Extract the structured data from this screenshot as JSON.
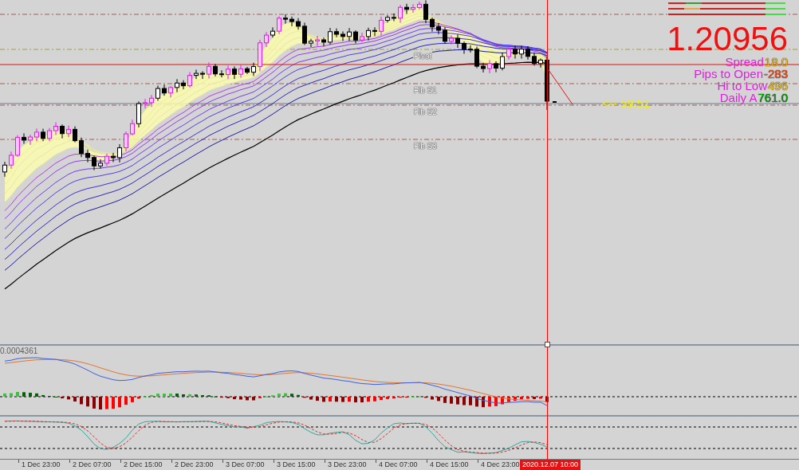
{
  "price_chart": {
    "current_price": "1.20956",
    "stats": [
      {
        "label": "Spread",
        "value": "18.0",
        "color": "#f0c010"
      },
      {
        "label": "Pips to Open",
        "value": "-283",
        "color": "#ff4a10"
      },
      {
        "label": "Hi to Low",
        "value": "496",
        "color": "#e8c030"
      },
      {
        "label": "Daily A",
        "value": "761.0",
        "color": "#00a000"
      }
    ],
    "countdown": "<-- 59:51",
    "levels": [
      {
        "label": "Pivot"
      },
      {
        "label": "Fib S1"
      },
      {
        "label": "Fib S2"
      },
      {
        "label": "Fib S3"
      }
    ]
  },
  "macd_panel": {
    "value_label": "0.0004361"
  },
  "time_axis": {
    "labels": [
      "1 Dec 23:00",
      "2 Dec 07:00",
      "2 Dec 15:00",
      "2 Dec 23:00",
      "3 Dec 07:00",
      "3 Dec 15:00",
      "3 Dec 23:00",
      "4 Dec 07:00",
      "4 Dec 15:00",
      "4 Dec 23:00"
    ],
    "cursor_label": "2020.12.07 10:00"
  }
}
